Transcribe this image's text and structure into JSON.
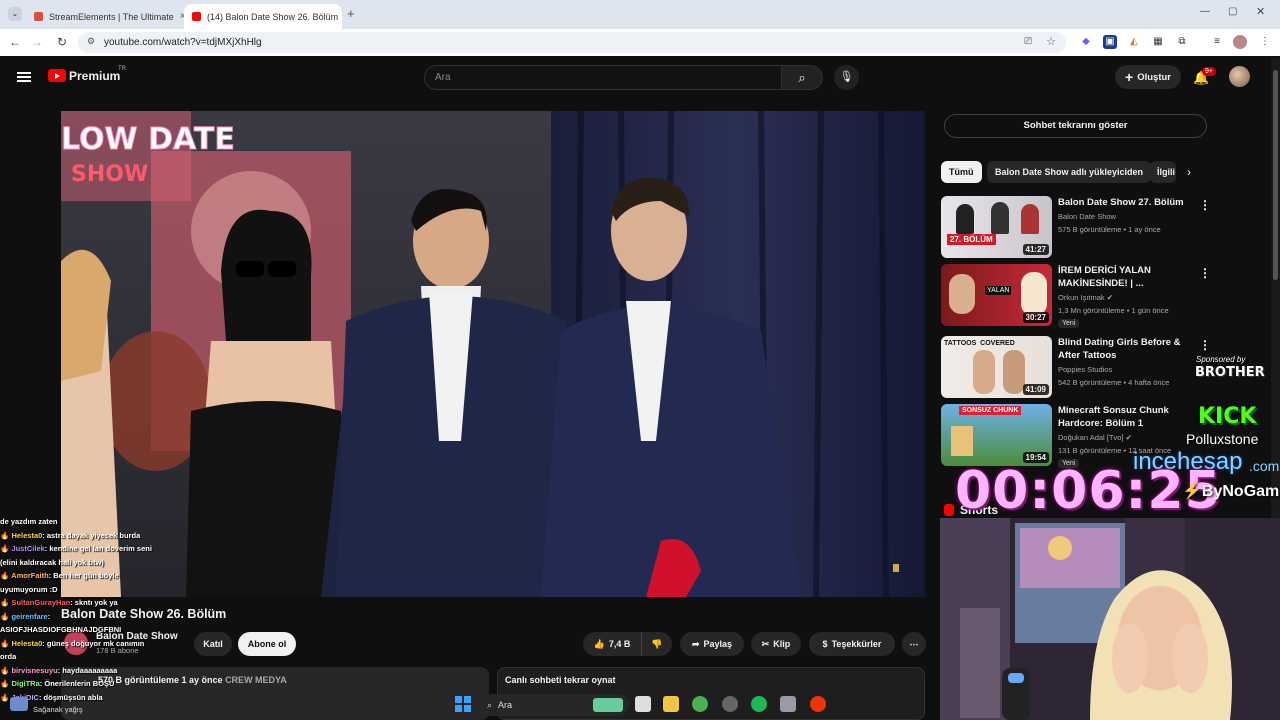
{
  "browser": {
    "tabs": [
      {
        "title": "StreamElements | The Ultimate",
        "active": false
      },
      {
        "title": "(14) Balon Date Show 26. Bölüm",
        "active": true
      }
    ],
    "new_tab": "+",
    "url": "youtube.com/watch?v=tdjMXjXhHlg"
  },
  "header": {
    "logo": "Premium",
    "region": "TR",
    "search_placeholder": "Ara",
    "create_label": "Oluştur",
    "notification_count": "9+"
  },
  "video": {
    "title": "Balon Date Show 26. Bölüm",
    "overlay_text": "LOW DATE SHOW",
    "channel": "Balon Date Show",
    "subscribers": "178 B abone",
    "join_label": "Katıl",
    "subscribe_label": "Abone ol",
    "likes": "7,4 B",
    "share_label": "Paylaş",
    "clip_label": "Klip",
    "thanks_label": "Teşekkürler",
    "views_info": "570 B görüntüleme  1 ay önce",
    "tag": "CREW MEDYA",
    "replay_label": "Canlı sohbeti tekrar oynat"
  },
  "sidebar": {
    "show_chat_label": "Sohbet tekrarını göster",
    "chips": [
      "Tümü",
      "Balon Date Show adlı yükleyiciden",
      "İlgili"
    ],
    "recommendations": [
      {
        "title": "Balon Date Show 27. Bölüm",
        "channel": "Balon Date Show",
        "meta": "575 B görüntüleme • 1 ay önce",
        "duration": "41:27",
        "thumb_text": "27. BÖLÜM",
        "new": false
      },
      {
        "title": "İREM DERİCİ YALAN MAKİNESİNDE! | ...",
        "channel": "Orkun Işıtmak",
        "meta": "1,3 Mn görüntüleme • 1 gün önce",
        "duration": "30:27",
        "thumb_text": "YALAN",
        "new": true
      },
      {
        "title": "Blind Dating Girls Before & After Tattoos",
        "channel": "Poppies Studios",
        "meta": "542 B görüntüleme • 4 hafta önce",
        "duration": "41:09",
        "thumb_text": "TATTOOS  COVERED",
        "new": false
      },
      {
        "title": "Minecraft Sonsuz Chunk Hardcore: Bölüm 1",
        "channel": "Doğukan Adal [Tvo]",
        "meta": "131 B görüntüleme • 12 saat önce",
        "duration": "19:54",
        "thumb_text": "SONSUZ CHUNK",
        "new": true
      }
    ],
    "new_badge": "Yeni",
    "shorts_label": "Shorts"
  },
  "stream_overlay": {
    "timer": "00:06:25",
    "sponsored_by": "Sponsored by",
    "sponsor_brand": "BROTHER",
    "kick_logo": "KICK",
    "kick_user": "Polluxstone",
    "incehesap": "incehesap",
    "incehesap_suffix": ".com",
    "bynogame": "ByNoGame",
    "chat": [
      {
        "user": "",
        "msg": "de yazdım zaten",
        "color": "#ffffff"
      },
      {
        "user": "Helesta0",
        "msg": ": astra dayak yiyecek burda",
        "color": "#ffd24a"
      },
      {
        "user": "JustCilek",
        "msg": ": kendine gel lan doverim seni (elini kaldıracak hali yok btw)",
        "color": "#b88cff"
      },
      {
        "user": "AmorFaith",
        "msg": ": Ben her gün böyle uyumuyorum :D",
        "color": "#ffb36b"
      },
      {
        "user": "SultanGurayHan",
        "msg": ": skntı yok ya",
        "color": "#ff5a5a"
      },
      {
        "user": "geirenfare",
        "msg": ": ASIOFJHASDIOFGBHNAJDGFBNI",
        "color": "#5ac8ff"
      },
      {
        "user": "Helesta0",
        "msg": ": güneş doğuyor mk canımın orda",
        "color": "#ffd24a"
      },
      {
        "user": "birvisnesuyu",
        "msg": ": haydaaaaaaaaa",
        "color": "#ff9ad5"
      },
      {
        "user": "DigiTRa",
        "msg": ": Önerilenlerin BOŞU",
        "color": "#7cff7c"
      },
      {
        "user": "JakiDIC",
        "msg": ": döşmüşsün abla",
        "color": "#c7a0ff"
      }
    ]
  },
  "taskbar": {
    "weather": "Sağanak yağış",
    "search_label": "Ara"
  }
}
